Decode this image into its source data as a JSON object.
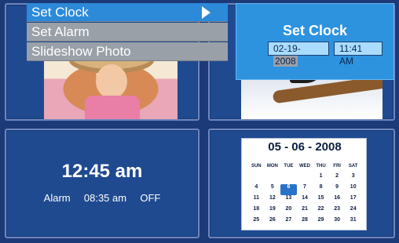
{
  "menu": {
    "items": [
      {
        "label": "Set Clock"
      },
      {
        "label": "Set Alarm"
      },
      {
        "label": "Slideshow Photo"
      }
    ]
  },
  "set_clock": {
    "title": "Set Clock",
    "date_prefix": "02-19-",
    "date_year": "2008",
    "time": "11:41 AM"
  },
  "clock": {
    "time": "12:45 am",
    "alarm_label": "Alarm",
    "alarm_time": "08:35 am",
    "alarm_state": "OFF"
  },
  "calendar": {
    "title": "05 - 06 - 2008",
    "days": [
      "SUN",
      "MON",
      "TUE",
      "WED",
      "THU",
      "FRI",
      "SAT"
    ],
    "cells": [
      "",
      "",
      "",
      "",
      "1",
      "2",
      "3",
      "4",
      "5",
      "6",
      "7",
      "8",
      "9",
      "10",
      "11",
      "12",
      "13",
      "14",
      "15",
      "16",
      "17",
      "18",
      "19",
      "20",
      "21",
      "22",
      "23",
      "24",
      "25",
      "26",
      "27",
      "28",
      "29",
      "30",
      "31"
    ],
    "highlight": "6"
  },
  "colors": {
    "background": "#1d3a78",
    "menu_selected": "#2c8ad9",
    "menu_unselected": "#9aa0a8"
  }
}
